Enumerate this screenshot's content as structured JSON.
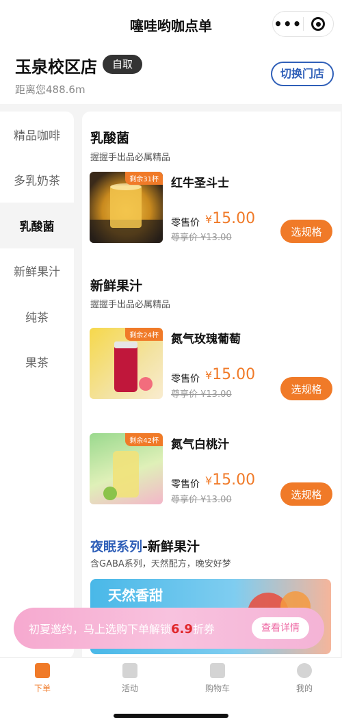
{
  "app": {
    "title": "噻哇哟咖点单"
  },
  "store": {
    "name": "玉泉校区店",
    "pickup_label": "自取",
    "distance": "距离您488.6m",
    "switch_label": "切换门店"
  },
  "categories": [
    {
      "label": "精品咖啡",
      "active": false
    },
    {
      "label": "多乳奶茶",
      "active": false
    },
    {
      "label": "乳酸菌",
      "active": true
    },
    {
      "label": "新鲜果汁",
      "active": false
    },
    {
      "label": "纯茶",
      "active": false
    },
    {
      "label": "果茶",
      "active": false
    }
  ],
  "sections": [
    {
      "title": "乳酸菌",
      "subtitle": "握握手出品必属精品",
      "products": [
        {
          "name": "红牛圣斗士",
          "stock": "剩余31杯",
          "price_label": "零售价",
          "currency": "¥",
          "price": "15.00",
          "member_price": "尊享价 ¥13.00",
          "button": "选规格"
        }
      ]
    },
    {
      "title": "新鲜果汁",
      "subtitle": "握握手出品必属精品",
      "products": [
        {
          "name": "氮气玫瑰葡萄",
          "stock": "剩余24杯",
          "price_label": "零售价",
          "currency": "¥",
          "price": "15.00",
          "member_price": "尊享价 ¥13.00",
          "button": "选规格"
        },
        {
          "name": "氮气白桃汁",
          "stock": "剩余42杯",
          "price_label": "零售价",
          "currency": "¥",
          "price": "15.00",
          "member_price": "尊享价 ¥13.00",
          "button": "选规格"
        }
      ]
    },
    {
      "title_highlight": "夜眠系列",
      "title_rest": "-新鲜果汁",
      "subtitle": "含GABA系列，天然配方，晚安好梦"
    }
  ],
  "banner": {
    "text": "天然香甜"
  },
  "promo": {
    "text_before": "初夏邀约，马上选购下单解锁",
    "highlight": "6.9",
    "text_after": "折券",
    "detail_label": "查看详情"
  },
  "tabs": [
    {
      "label": "下单",
      "active": true
    },
    {
      "label": "活动",
      "active": false
    },
    {
      "label": "购物车",
      "active": false
    },
    {
      "label": "我的",
      "active": false
    }
  ],
  "colors": {
    "accent": "#f07a28",
    "link": "#2f5fb8",
    "promo": "#f4b3d6"
  }
}
